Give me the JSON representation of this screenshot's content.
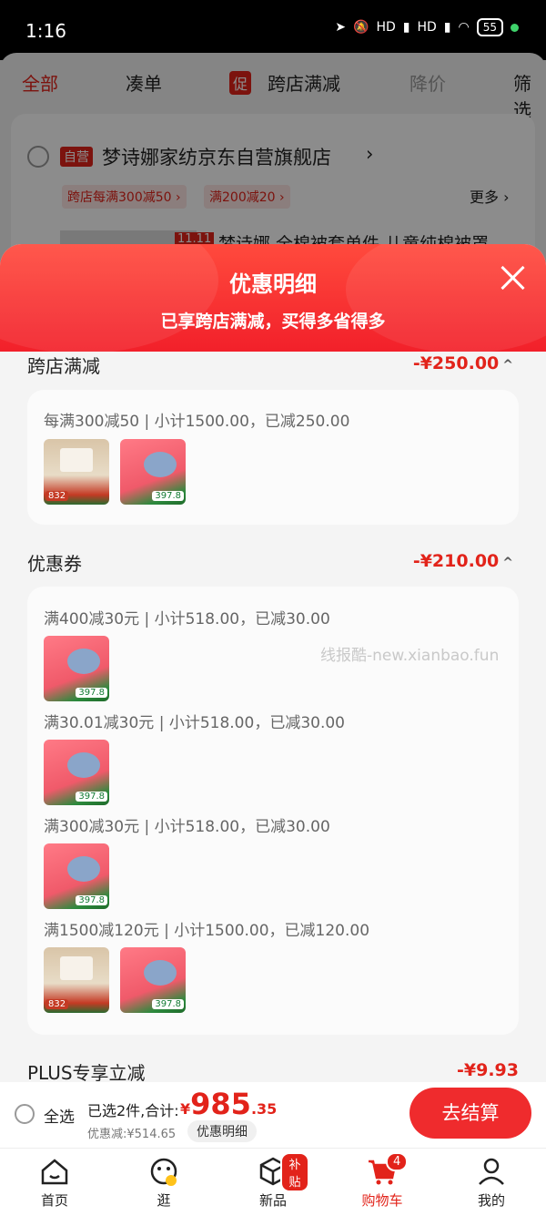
{
  "status_bar": {
    "time": "1:16",
    "battery": "55",
    "net1": "HD",
    "net2": "HD"
  },
  "tabs": [
    "全部",
    "凑单",
    "跨店满减",
    "降价",
    "筛选"
  ],
  "promo_badge": "促",
  "store": {
    "self_tag": "自营",
    "name": "梦诗娜家纺京东自营旗舰店",
    "chevron": "›",
    "promos": [
      "跨店每满300减50 ›",
      "满200减20 ›"
    ],
    "more": "更多 ›",
    "product_title": "梦诗娜 全棉被套单件 儿童纯棉被罩",
    "tag_11": "11.11"
  },
  "sheet": {
    "title": "优惠明细",
    "subtitle": "已享跨店满减，买得多省得多"
  },
  "cross_store": {
    "title": "跨店满减",
    "amount": "-¥250.00",
    "rule": "每满300减50 | 小计1500.00，已减250.00"
  },
  "coupons": {
    "title": "优惠券",
    "amount": "-¥210.00",
    "rules": [
      "满400减30元 | 小计518.00，已减30.00",
      "满30.01减30元 | 小计518.00，已减30.00",
      "满300减30元 | 小计518.00，已减30.00",
      "满1500减120元 | 小计1500.00，已减120.00"
    ]
  },
  "plus": {
    "title": "PLUS专享立减",
    "amount": "-¥9.93"
  },
  "thumb_prices": {
    "a": "832",
    "b": "397.8"
  },
  "watermark": "线报酷-new.xianbao.fun",
  "footer": {
    "select_all": "全选",
    "selected": "已选2件,合计:",
    "currency": "¥",
    "total_int": "985",
    "total_dec": ".35",
    "discount": "优惠减:¥514.65",
    "detail_btn": "优惠明细",
    "checkout": "去结算"
  },
  "nav": [
    {
      "label": "首页"
    },
    {
      "label": "逛"
    },
    {
      "label": "新品",
      "badge": "补贴"
    },
    {
      "label": "购物车",
      "badge": "4"
    },
    {
      "label": "我的"
    }
  ],
  "colors": {
    "brand": "#e2231a",
    "checkout": "#ef2b2d"
  }
}
